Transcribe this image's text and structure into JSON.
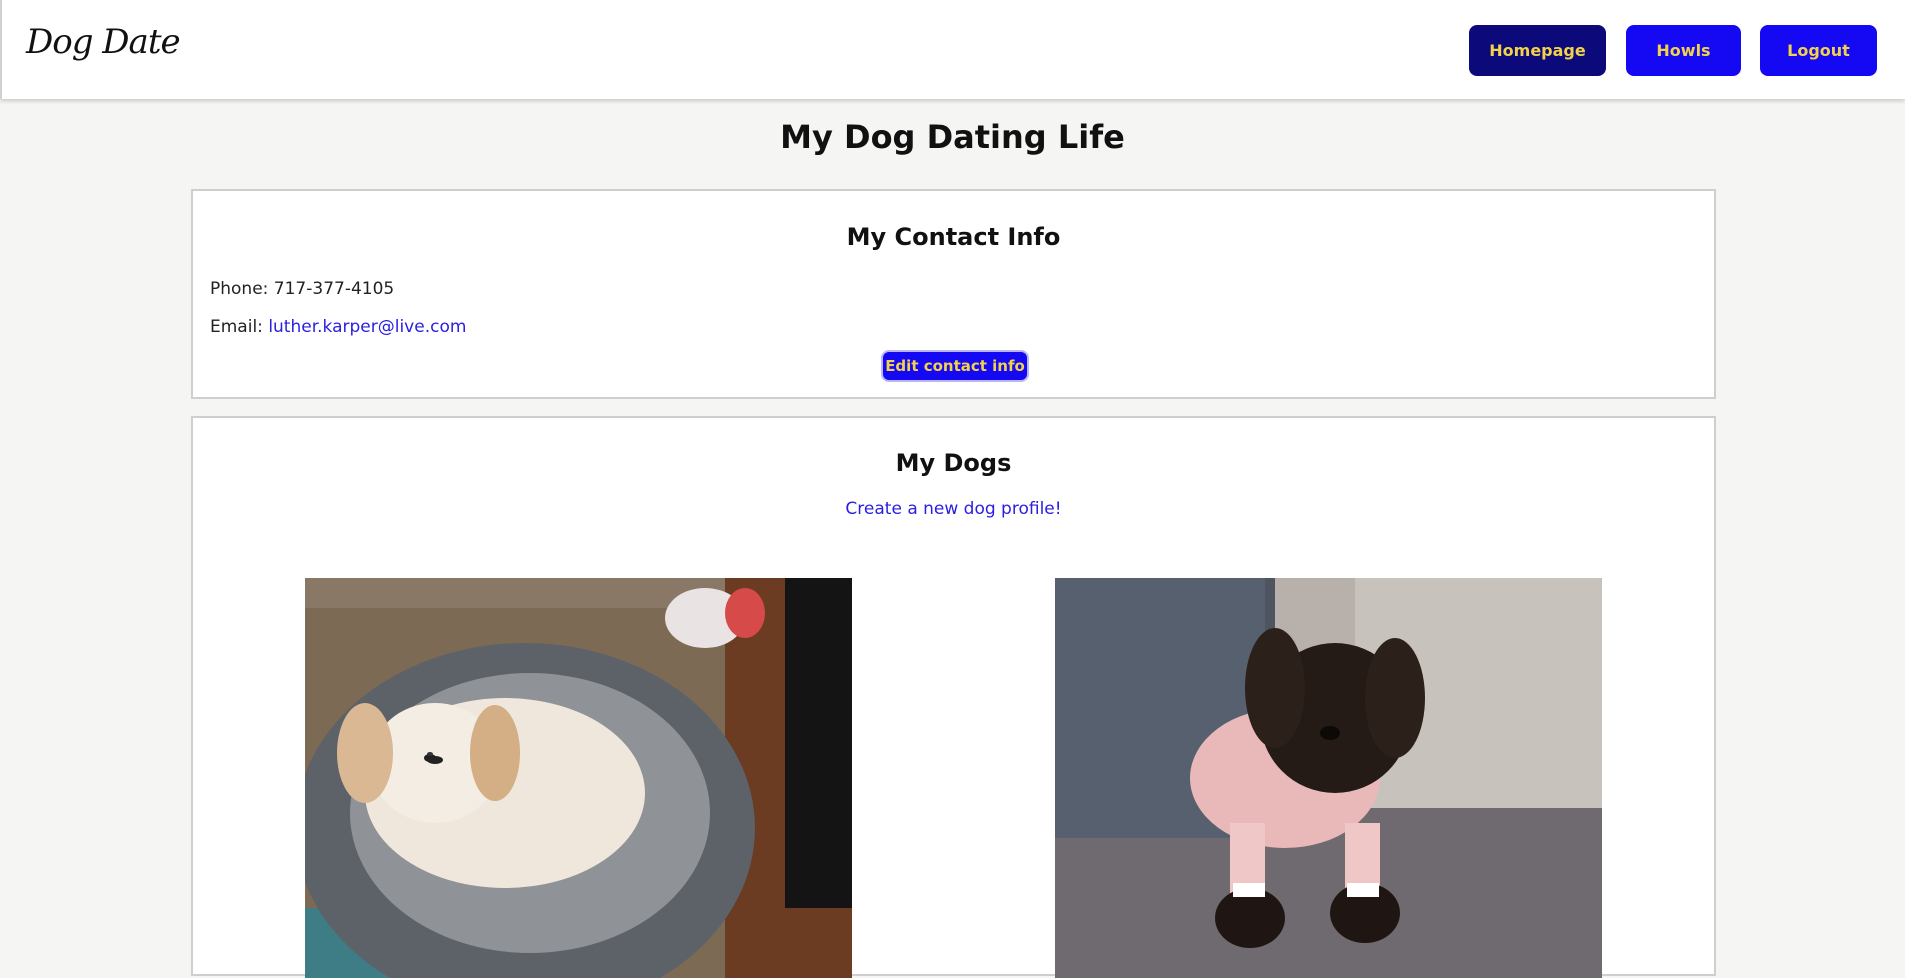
{
  "navbar": {
    "brand": "Dog Date",
    "buttons": {
      "homepage": "Homepage",
      "howls": "Howls",
      "logout": "Logout"
    }
  },
  "page": {
    "title": "My Dog Dating Life"
  },
  "contact": {
    "title": "My Contact Info",
    "phone_label": "Phone:",
    "phone": "717-377-4105",
    "email_label": "Email:",
    "email": "luther.karper@live.com",
    "edit_button": "Edit contact info"
  },
  "dogs": {
    "title": "My Dogs",
    "create_link": "Create a new dog profile!",
    "photos": [
      {
        "subject": "white-fluffy-dog-in-gray-bed"
      },
      {
        "subject": "dark-brown-dog-in-pink-pajamas"
      }
    ]
  },
  "colors": {
    "nav_active": "#0c0a7a",
    "primary": "#1508f2",
    "button_text": "#f2d24a",
    "link": "#2a1ee0",
    "background": "#f5f5f3"
  }
}
